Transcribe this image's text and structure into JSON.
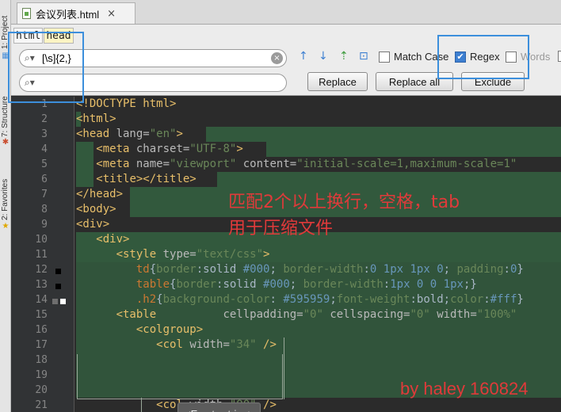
{
  "tool_strip": {
    "project": "1: Project",
    "structure": "7: Structure",
    "favorites": "2: Favorites"
  },
  "tab": {
    "file_name": "会议列表.html",
    "close_glyph": "×"
  },
  "breadcrumb": [
    "html",
    "head"
  ],
  "find": {
    "search_value": "[\\s]{2,}",
    "replace_value": "",
    "search_icon": "⌕▾",
    "clear_glyph": "×",
    "nav_icons": [
      "↑",
      "↓",
      "⇡",
      "⊡"
    ],
    "match_case": {
      "label": "Match Case",
      "checked": false
    },
    "regex": {
      "label": "Regex",
      "checked": true
    },
    "words": {
      "label": "Words",
      "checked": false
    },
    "buttons": {
      "replace": "Replace",
      "replace_all": "Replace all",
      "exclude": "Exclude"
    }
  },
  "editor": {
    "line_numbers": [
      "1",
      "2",
      "3",
      "4",
      "5",
      "6",
      "7",
      "8",
      "9",
      "10",
      "11",
      "12",
      "13",
      "14",
      "15",
      "16",
      "17",
      "18",
      "19",
      "20",
      "21"
    ],
    "tooltip": "<Empty string>",
    "annotation_line1": "匹配2个以上换行，空格，tab",
    "annotation_line2": "用于压缩文件",
    "signature": "by haley 160824"
  },
  "colors": {
    "tag": "#e8bf6a",
    "attr_value": "#6a8759",
    "match_highlight": "#32593d",
    "annotation": "#e03a3a",
    "callout": "#3c8fdc"
  }
}
